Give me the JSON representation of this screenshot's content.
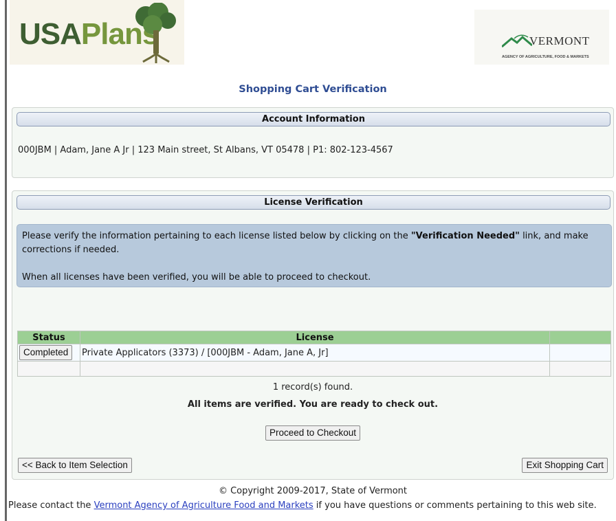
{
  "header": {
    "logo_left": {
      "part1": "USA",
      "part2": "Plan",
      "part3": "s"
    },
    "logo_right": {
      "name": "VERMONT",
      "agency": "AGENCY OF AGRICULTURE, FOOD & MARKETS"
    }
  },
  "page": {
    "title": "Shopping Cart Verification"
  },
  "account": {
    "header": "Account Information",
    "details": "000JBM | Adam, Jane A Jr | 123 Main street, St Albans, VT 05478 | P1: 802-123-4567"
  },
  "license": {
    "header": "License Verification",
    "notice_pre": "Please verify the information pertaining to each license listed below by clicking on the ",
    "notice_strong": "\"Verification Needed\"",
    "notice_post": " link, and make corrections if needed.",
    "notice_2": "When all licenses have been verified, you will be able to proceed to checkout.",
    "table": {
      "columns": [
        "Status",
        "License",
        ""
      ],
      "rows": [
        {
          "status": "Completed",
          "license": "Private Applicators (3373) / [000JBM - Adam, Jane A, Jr]"
        }
      ]
    },
    "records": "1 record(s) found.",
    "verified_msg": "All items are verified. You are ready to check out.",
    "checkout_button": "Proceed to Checkout",
    "back_button": "<< Back to Item Selection",
    "exit_button": "Exit Shopping Cart"
  },
  "footer": {
    "copyright": "© Copyright 2009-2017, State of Vermont",
    "contact_pre": "Please contact the ",
    "contact_link": "Vermont Agency of Agriculture Food and Markets",
    "contact_post": " if you have questions or comments pertaining to this web site."
  }
}
